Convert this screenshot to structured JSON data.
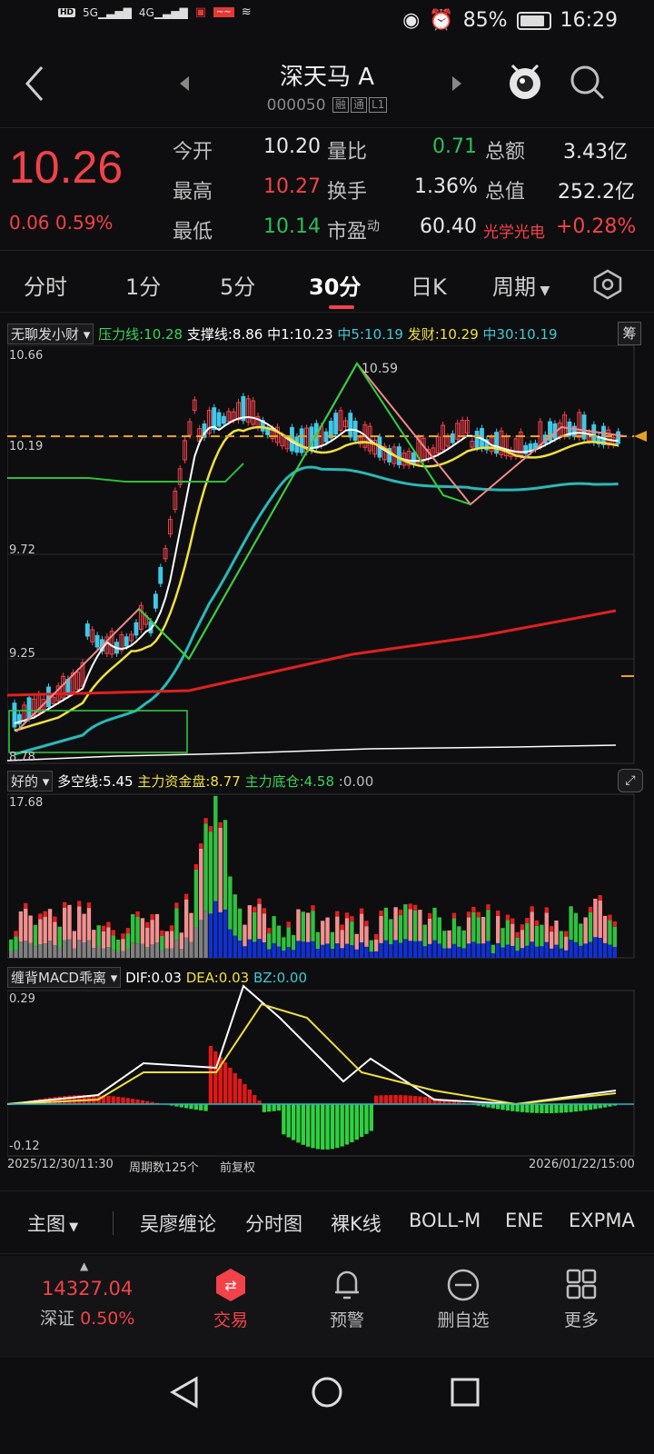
{
  "status": {
    "left_icons": [
      "HD1",
      "HD2",
      "5G",
      "4G"
    ],
    "battery": "85%",
    "time": "16:29"
  },
  "header": {
    "title": "深天马 A",
    "code": "000050",
    "tags": [
      "融",
      "通",
      "L1"
    ]
  },
  "quote": {
    "price": "10.26",
    "change": "0.06",
    "change_pct": "0.59%",
    "rows": [
      [
        {
          "label": "今开",
          "value": "10.20",
          "color": "white"
        },
        {
          "label": "量比",
          "value": "0.71",
          "color": "green"
        },
        {
          "label": "总额",
          "value": "3.43亿",
          "color": "white"
        }
      ],
      [
        {
          "label": "最高",
          "value": "10.27",
          "color": "red"
        },
        {
          "label": "换手",
          "value": "1.36%",
          "color": "white"
        },
        {
          "label": "总值",
          "value": "252.2亿",
          "color": "white"
        }
      ],
      [
        {
          "label": "最低",
          "value": "10.14",
          "color": "green"
        },
        {
          "label": "市盈",
          "label_sup": "动",
          "value": "60.40",
          "color": "white"
        },
        {
          "label": "光学光电",
          "value": "+0.28%",
          "color": "red"
        }
      ]
    ]
  },
  "tabs": [
    "分时",
    "1分",
    "5分",
    "30分",
    "日K",
    "周期"
  ],
  "active_tab": "30分",
  "main_indicator": {
    "name": "无聊发小财",
    "items": [
      {
        "text": "压力线:10.28",
        "color": "#3ad45a"
      },
      {
        "text": "支撑线:8.86",
        "color": "#ffffff"
      },
      {
        "text": "中1:10.23",
        "color": "#ffffff"
      },
      {
        "text": "中5:10.19",
        "color": "#40c8d0"
      },
      {
        "text": "发财:10.29",
        "color": "#f0e040"
      },
      {
        "text": "中30:10.19",
        "color": "#40c8d0"
      }
    ],
    "chip_button": "筹",
    "y_labels": [
      "10.66",
      "10.19",
      "9.72",
      "9.25",
      "8.78"
    ],
    "peak_label": "10.59"
  },
  "sub1": {
    "name": "好的",
    "items": [
      {
        "text": "多空线:5.45",
        "color": "#ffffff"
      },
      {
        "text": "主力资金盘:8.77",
        "color": "#f0e040"
      },
      {
        "text": "主力底仓:4.58",
        "color": "#3ad45a"
      },
      {
        "text": ":0.00",
        "color": "#bbbbbb"
      }
    ],
    "y_top": "17.68"
  },
  "sub2": {
    "name": "缠背MACD乖离",
    "items": [
      {
        "text": "DIF:0.03",
        "color": "#ffffff"
      },
      {
        "text": "DEA:0.03",
        "color": "#f0e040"
      },
      {
        "text": "BZ:0.00",
        "color": "#40c8d0"
      }
    ],
    "y_top": "0.29",
    "y_bottom": "-0.12"
  },
  "footer_axis": {
    "start": "2025/12/30/11:30",
    "count": "周期数125个",
    "adjust": "前复权",
    "end": "2026/01/22/15:00"
  },
  "toolbar": [
    "主图",
    "吴廖缠论",
    "分时图",
    "裸K线",
    "BOLL-M",
    "ENE",
    "EXPMA"
  ],
  "bottom_nav": {
    "index_value": "14327.04",
    "index_name": "深证",
    "index_pct": "0.50%",
    "items": [
      "交易",
      "预警",
      "删自选",
      "更多"
    ]
  }
}
